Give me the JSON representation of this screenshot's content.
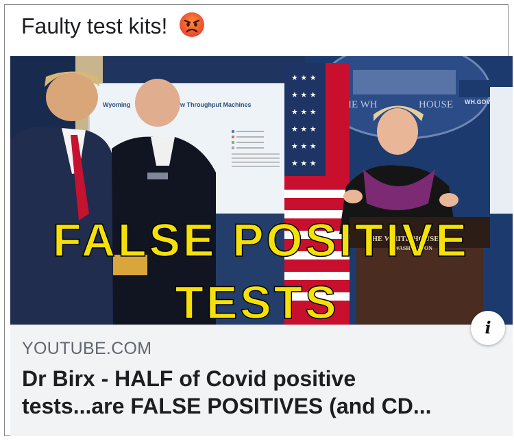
{
  "post": {
    "text": "Faulty test kits!",
    "emoji": "angry-face-emoji"
  },
  "link_card": {
    "image": {
      "overlay_line1": "FALSE POSITIVE",
      "overlay_line2": "TESTS",
      "overlay_color": "#f5e10a",
      "slide_title_left": "Wyoming",
      "slide_title_right": "w Throughput Machines",
      "seal_text_1": "THE WH",
      "seal_text_2": "HOUSE",
      "wh_gov": "WH.GOV",
      "podium_line1": "THE WHITE HOUSE",
      "podium_line2": "WASHINGTON"
    },
    "info_icon": "i",
    "domain": "YOUTUBE.COM",
    "title_line1": "Dr Birx - HALF of Covid positive",
    "title_line2": "tests...are FALSE POSITIVES (and CD..."
  }
}
